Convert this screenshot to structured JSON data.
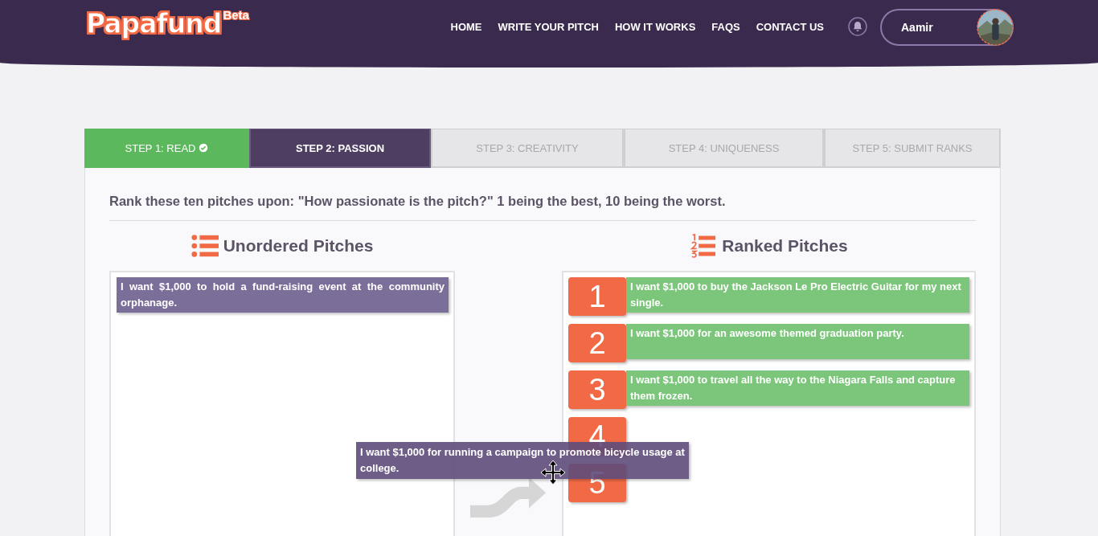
{
  "header": {
    "logo": "Papafund",
    "logo_badge": "Beta",
    "nav": [
      "HOME",
      "WRITE YOUR PITCH",
      "HOW IT WORKS",
      "FAQS",
      "CONTACT US"
    ],
    "user": {
      "name": "Aamir"
    }
  },
  "steps": [
    {
      "label": "STEP 1: READ",
      "selected": false,
      "completed": true
    },
    {
      "label": "STEP 2: PASSION",
      "selected": true,
      "completed": false
    },
    {
      "label": "STEP 3: CREATIVITY",
      "selected": false,
      "completed": false
    },
    {
      "label": "STEP 4: UNIQUENESS",
      "selected": false,
      "completed": false
    },
    {
      "label": "STEP 5: SUBMIT RANKS",
      "selected": false,
      "completed": false
    }
  ],
  "instruction": "Rank these ten pitches upon: \"How passionate is the pitch?\" 1 being the best, 10 being the worst.",
  "unordered": {
    "title": "Unordered Pitches",
    "items": [
      "I want $1,000 to hold a fund-raising event at the community orphanage."
    ]
  },
  "ranked": {
    "title": "Ranked Pitches",
    "slots": [
      {
        "rank": "1",
        "text": "I want $1,000 to buy the Jackson Le Pro Electric Guitar for my next single."
      },
      {
        "rank": "2",
        "text": "I want $1,000 for an awesome themed graduation party."
      },
      {
        "rank": "3",
        "text": "I want $1,000 to travel all the way to the Niagara Falls and capture them frozen."
      },
      {
        "rank": "4"
      },
      {
        "rank": "5"
      }
    ]
  },
  "dragging": {
    "text": "I want $1,000 for running a campaign to promote bicycle usage at college."
  }
}
